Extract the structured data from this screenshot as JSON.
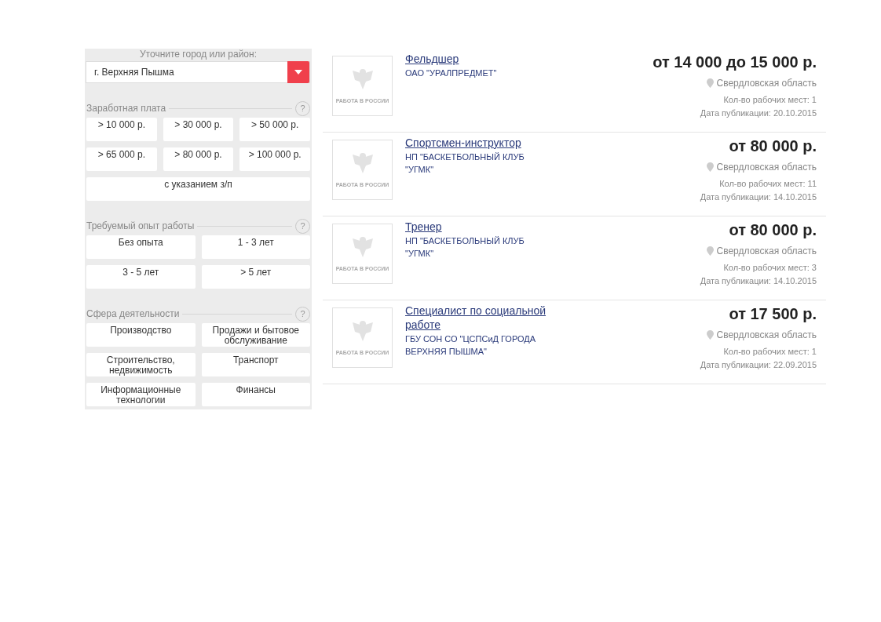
{
  "filters": {
    "city_label": "Уточните город или район:",
    "city_value": "г. Верхняя Пышма",
    "sections": [
      {
        "title": "Заработная плата",
        "help": "?",
        "kind": "three_column",
        "options": [
          {
            "label": "> 10 000 р.",
            "wide": false
          },
          {
            "label": "> 30 000 р.",
            "wide": false
          },
          {
            "label": "> 50 000 р.",
            "wide": false
          },
          {
            "label": "> 65 000 р.",
            "wide": false
          },
          {
            "label": "> 80 000 р.",
            "wide": false
          },
          {
            "label": "> 100 000 р.",
            "wide": false
          },
          {
            "label": "с указанием з/п",
            "wide": true
          }
        ]
      },
      {
        "title": "Требуемый опыт работы",
        "help": "?",
        "kind": "two_column",
        "options": [
          {
            "label": "Без опыта",
            "wide": false
          },
          {
            "label": "1 - 3 лет",
            "wide": false
          },
          {
            "label": "3 - 5 лет",
            "wide": false
          },
          {
            "label": "> 5 лет",
            "wide": false
          }
        ]
      },
      {
        "title": "Сфера деятельности",
        "help": "?",
        "kind": "two_column",
        "options": [
          {
            "label": "Производство",
            "wide": false
          },
          {
            "label": "Продажи и бытовое обслуживание",
            "wide": false
          },
          {
            "label": "Строительство, недвижимость",
            "wide": false
          },
          {
            "label": "Транспорт",
            "wide": false
          },
          {
            "label": "Информационные технологии",
            "wide": false
          },
          {
            "label": "Финансы",
            "wide": false
          }
        ]
      }
    ]
  },
  "vacancies": [
    {
      "logo_caption": "РАБОТА В РОССИИ",
      "title": "Фельдшер",
      "employer": "ОАО \"УРАЛПРЕДМЕТ\"",
      "salary": "от 14 000 до 15 000 р.",
      "region": "Свердловская область",
      "places": "Кол-во рабочих мест: 1",
      "date": "Дата публикации: 20.10.2015"
    },
    {
      "logo_caption": "РАБОТА В РОССИИ",
      "title": "Спортсмен-инструктор",
      "employer": "НП \"БАСКЕТБОЛЬНЫЙ КЛУБ \"УГМК\"",
      "salary": "от 80 000 р.",
      "region": "Свердловская область",
      "places": "Кол-во рабочих мест: 11",
      "date": "Дата публикации: 14.10.2015"
    },
    {
      "logo_caption": "РАБОТА В РОССИИ",
      "title": "Тренер",
      "employer": "НП \"БАСКЕТБОЛЬНЫЙ КЛУБ \"УГМК\"",
      "salary": "от 80 000 р.",
      "region": "Свердловская область",
      "places": "Кол-во рабочих мест: 3",
      "date": "Дата публикации: 14.10.2015"
    },
    {
      "logo_caption": "РАБОТА В РОССИИ",
      "title": "Специалист по социальной работе",
      "employer": "ГБУ СОН СО \"ЦСПСиД ГОРОДА ВЕРХНЯЯ ПЫШМА\"",
      "salary": "от 17 500 р.",
      "region": "Свердловская область",
      "places": "Кол-во рабочих мест: 1",
      "date": "Дата публикации: 22.09.2015"
    }
  ]
}
